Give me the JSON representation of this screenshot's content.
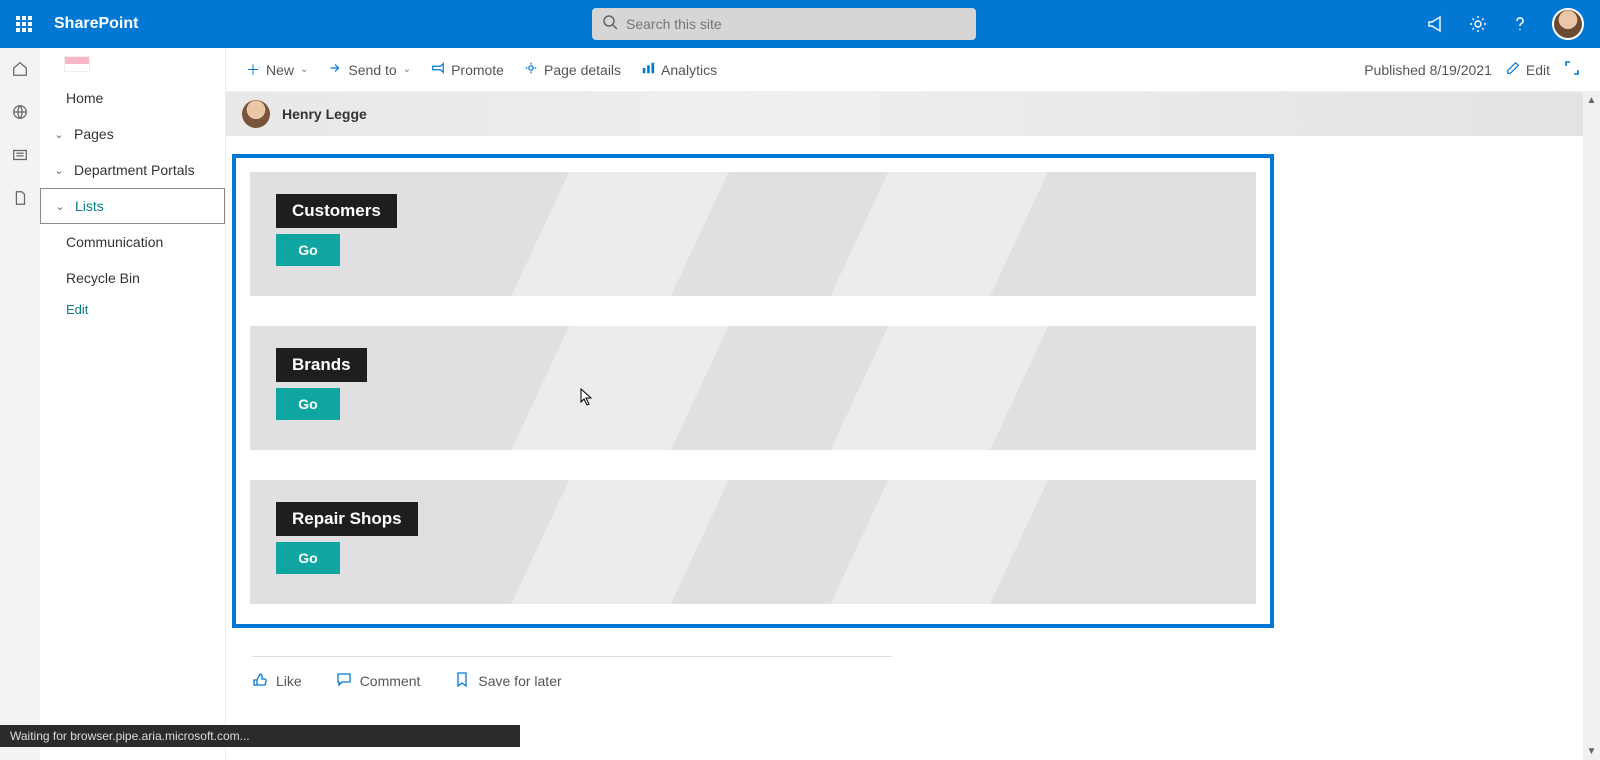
{
  "brand": "SharePoint",
  "search": {
    "placeholder": "Search this site"
  },
  "side_nav": {
    "items": [
      {
        "label": "Home",
        "chevron": false,
        "selected": false
      },
      {
        "label": "Pages",
        "chevron": true,
        "selected": false
      },
      {
        "label": "Department Portals",
        "chevron": true,
        "selected": false
      },
      {
        "label": "Lists",
        "chevron": true,
        "selected": true
      },
      {
        "label": "Communication",
        "chevron": false,
        "selected": false
      },
      {
        "label": "Recycle Bin",
        "chevron": false,
        "selected": false
      }
    ],
    "edit_label": "Edit"
  },
  "command_bar": {
    "new": "New",
    "send_to": "Send to",
    "promote": "Promote",
    "page_details": "Page details",
    "analytics": "Analytics",
    "published": "Published 8/19/2021",
    "edit": "Edit"
  },
  "author": {
    "name": "Henry Legge"
  },
  "webpart": {
    "cards": [
      {
        "title": "Customers",
        "button": "Go"
      },
      {
        "title": "Brands",
        "button": "Go"
      },
      {
        "title": "Repair Shops",
        "button": "Go"
      }
    ]
  },
  "social": {
    "like": "Like",
    "comment": "Comment",
    "save": "Save for later"
  },
  "status": "Waiting for browser.pipe.aria.microsoft.com..."
}
